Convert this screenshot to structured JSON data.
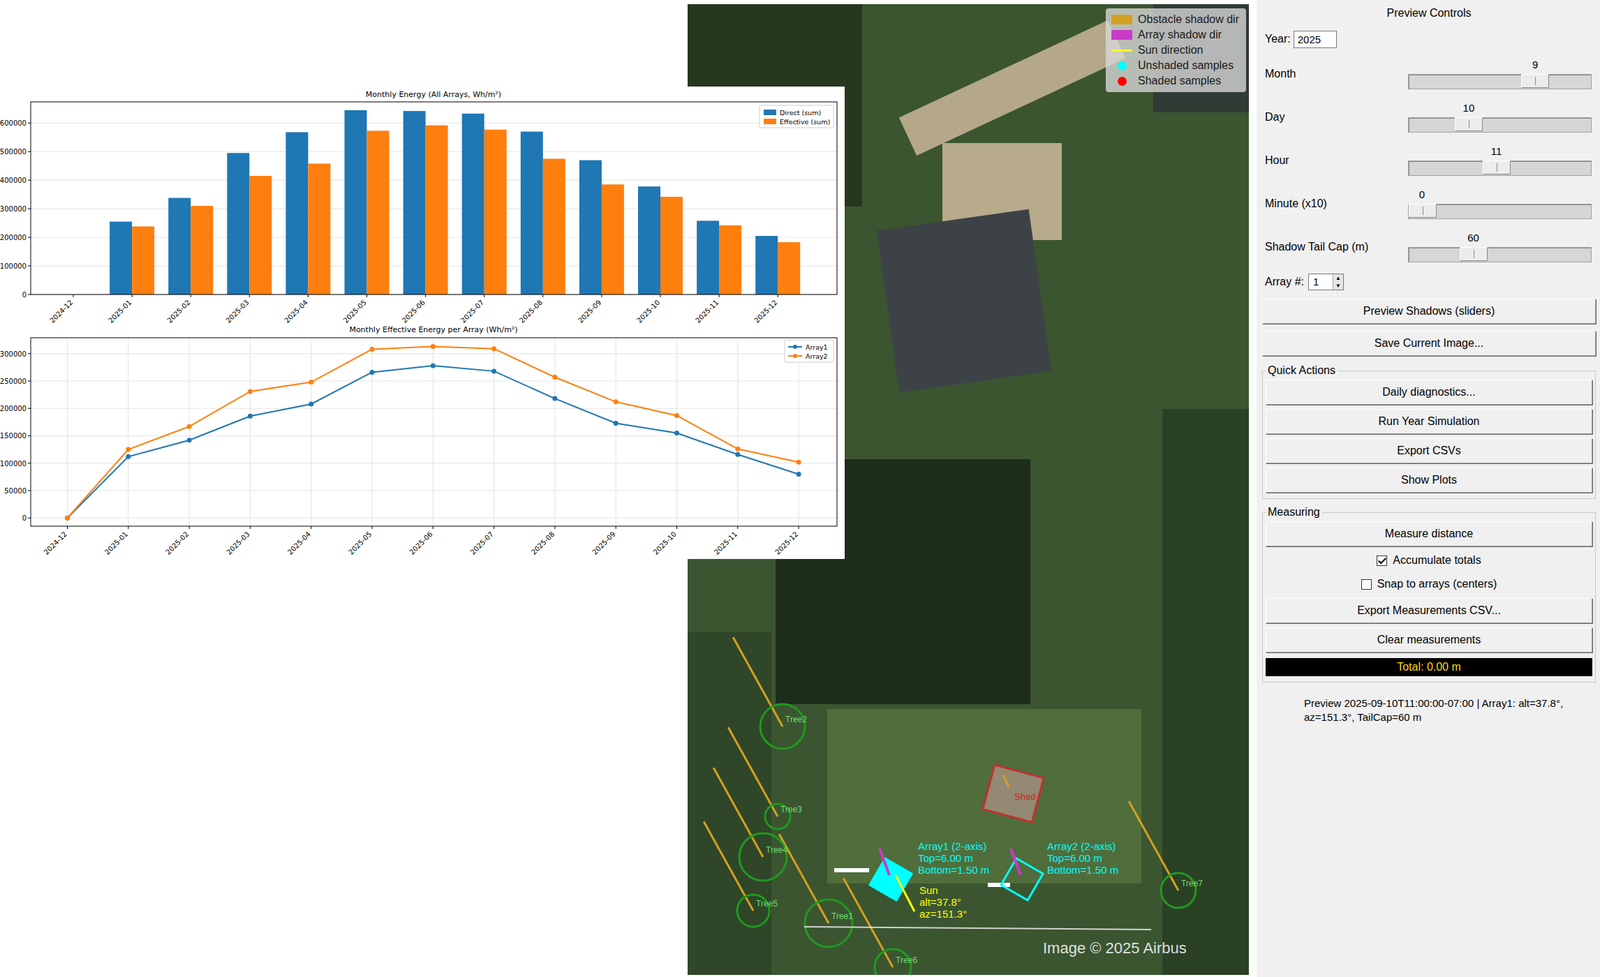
{
  "chart_window": {
    "energy_chart": {
      "title": "Monthly Energy (All Arrays, Wh/m²)",
      "categories": [
        "2024-12",
        "2025-01",
        "2025-02",
        "2025-03",
        "2025-04",
        "2025-05",
        "2025-06",
        "2025-07",
        "2025-08",
        "2025-09",
        "2025-10",
        "2025-11",
        "2025-12"
      ],
      "y_ticks": [
        "0",
        "100000",
        "200000",
        "300000",
        "400000",
        "500000",
        "600000"
      ],
      "series": [
        {
          "name": "Direct (sum)",
          "color": "#1f77b4",
          "values": [
            0,
            255000,
            338000,
            495000,
            568000,
            645000,
            642000,
            633000,
            570000,
            470000,
            378000,
            258000,
            205000
          ]
        },
        {
          "name": "Effective (sum)",
          "color": "#ff7f0e",
          "values": [
            0,
            238000,
            310000,
            415000,
            458000,
            573000,
            592000,
            577000,
            475000,
            385000,
            342000,
            242000,
            183000
          ]
        }
      ]
    },
    "array_chart": {
      "title": "Monthly Effective Energy per Array (Wh/m²)",
      "categories": [
        "2024-12",
        "2025-01",
        "2025-02",
        "2025-03",
        "2025-04",
        "2025-05",
        "2025-06",
        "2025-07",
        "2025-08",
        "2025-09",
        "2025-10",
        "2025-11",
        "2025-12"
      ],
      "y_ticks": [
        "0",
        "50000",
        "100000",
        "150000",
        "200000",
        "250000",
        "300000"
      ],
      "series": [
        {
          "name": "Array1",
          "color": "#1f77b4",
          "values": [
            0,
            112000,
            142000,
            186000,
            208000,
            266000,
            278000,
            268000,
            218000,
            173000,
            155000,
            116000,
            80000
          ]
        },
        {
          "name": "Array2",
          "color": "#ff7f0e",
          "values": [
            0,
            125000,
            167000,
            231000,
            248000,
            308000,
            313000,
            309000,
            257000,
            212000,
            187000,
            126000,
            102000
          ]
        }
      ]
    }
  },
  "map": {
    "legend": [
      {
        "label": "Obstacle shadow dir",
        "kind": "swatch",
        "color": "#d4a020"
      },
      {
        "label": "Array shadow dir",
        "kind": "swatch",
        "color": "#c83cc8"
      },
      {
        "label": "Sun direction",
        "kind": "line",
        "color": "#ffff00"
      },
      {
        "label": "Unshaded samples",
        "kind": "dot",
        "color": "#00ffff"
      },
      {
        "label": "Shaded samples",
        "kind": "dot",
        "color": "#ff0000"
      }
    ],
    "trees": [
      {
        "label": "Tree1"
      },
      {
        "label": "Tree2"
      },
      {
        "label": "Tree3"
      },
      {
        "label": "Tree4"
      },
      {
        "label": "Tree5"
      },
      {
        "label": "Tree6"
      },
      {
        "label": "Tree7"
      }
    ],
    "shed": {
      "label": "Shed"
    },
    "arrays": [
      {
        "name": "Array1 (2-axis)",
        "top": "Top=6.00 m",
        "bottom": "Bottom=1.50 m",
        "selected": true
      },
      {
        "name": "Array2 (2-axis)",
        "top": "Top=6.00 m",
        "bottom": "Bottom=1.50 m",
        "selected": false
      }
    ],
    "sun": {
      "label": "Sun",
      "alt": "alt=37.8°",
      "az": "az=151.3°"
    },
    "credit": "Image © 2025 Airbus"
  },
  "controls": {
    "title": "Preview Controls",
    "year": {
      "label": "Year:",
      "value": "2025"
    },
    "sliders": [
      {
        "label": "Month",
        "value": "9",
        "level": 0.727
      },
      {
        "label": "Day",
        "value": "10",
        "level": 0.3
      },
      {
        "label": "Hour",
        "value": "11",
        "level": 0.478
      },
      {
        "label": "Minute (x10)",
        "value": "0",
        "level": 0
      },
      {
        "label": "Shadow Tail Cap (m)",
        "value": "60",
        "level": 0.33
      }
    ],
    "array_select": {
      "label": "Array #:",
      "value": "1",
      "spin_up": "▲",
      "spin_down": "▼"
    },
    "buttons": [
      "Preview Shadows (sliders)",
      "Save Current Image..."
    ],
    "quick_actions": {
      "title": "Quick Actions",
      "buttons": [
        "Daily diagnostics...",
        "Run Year Simulation",
        "Export CSVs",
        "Show Plots"
      ]
    },
    "measuring": {
      "title": "Measuring",
      "items": [
        {
          "kind": "button",
          "label": "Measure distance"
        },
        {
          "kind": "checkbox",
          "label": "Accumulate totals",
          "checked": true
        },
        {
          "kind": "checkbox",
          "label": "Snap to arrays (centers)",
          "checked": false
        },
        {
          "kind": "button",
          "label": "Export Measurements CSV..."
        },
        {
          "kind": "button",
          "label": "Clear measurements"
        }
      ],
      "total": "Total: 0.00 m"
    },
    "status": "Preview 2025-09-10T11:00:00-07:00 | Array1: alt=37.8°, az=151.3°, TailCap=60 m"
  }
}
